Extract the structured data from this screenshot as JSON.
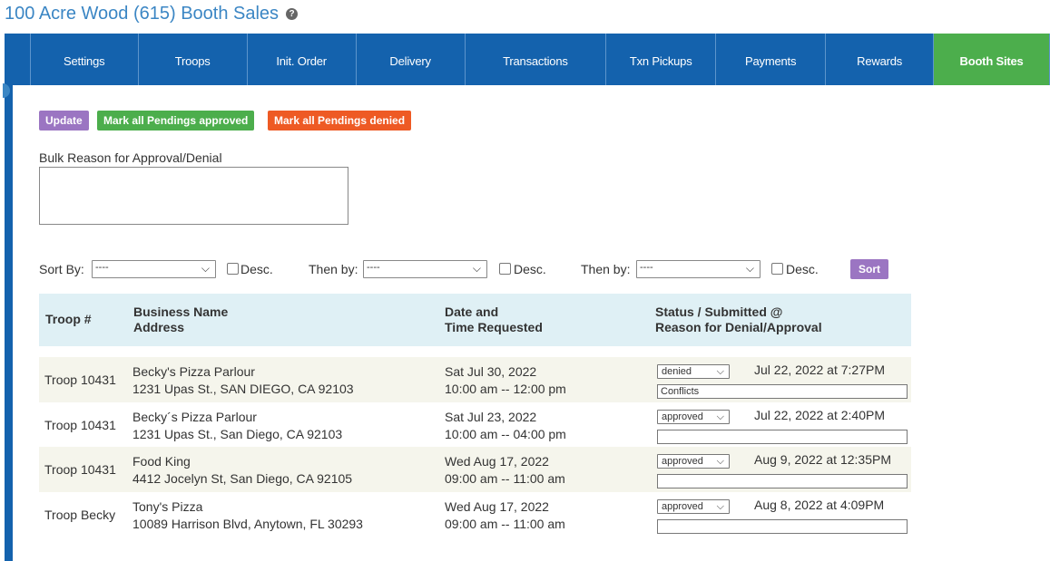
{
  "page_title": "100 Acre Wood (615) Booth Sales",
  "help_icon": "question-circle-icon",
  "nav": {
    "tabs": [
      "Settings",
      "Troops",
      "Init. Order",
      "Delivery",
      "Transactions",
      "Txn Pickups",
      "Payments",
      "Rewards",
      "Booth Sites"
    ],
    "active_tab": "Booth Sites"
  },
  "actions": {
    "update": "Update",
    "approve_all": "Mark all Pendings approved",
    "deny_all": "Mark all Pendings denied"
  },
  "bulk_reason": {
    "label": "Bulk Reason for Approval/Denial",
    "value": ""
  },
  "sort": {
    "sort_by_label": "Sort By:",
    "then_by_label": "Then by:",
    "select_value": "----",
    "desc_label": "Desc.",
    "button": "Sort"
  },
  "table": {
    "headers": {
      "troop": "Troop #",
      "business_1": "Business Name",
      "business_2": "Address",
      "date_1": "Date and",
      "date_2": "Time Requested",
      "status_1": "Status / Submitted @",
      "status_2": "Reason for Denial/Approval"
    },
    "rows": [
      {
        "troop": "Troop 10431",
        "business": "Becky's Pizza Parlour",
        "address": "1231 Upas St., SAN DIEGO, CA 92103",
        "date": "Sat Jul 30, 2022",
        "time": "10:00 am -- 12:00 pm",
        "status": "denied",
        "submitted": "Jul 22, 2022 at 7:27PM",
        "reason": "Conflicts"
      },
      {
        "troop": "Troop 10431",
        "business": "Becky´s Pizza Parlour",
        "address": "1231 Upas St., San Diego, CA 92103",
        "date": "Sat Jul 23, 2022",
        "time": "10:00 am -- 04:00 pm",
        "status": "approved",
        "submitted": "Jul 22, 2022 at 2:40PM",
        "reason": ""
      },
      {
        "troop": "Troop 10431",
        "business": "Food King",
        "address": "4412 Jocelyn St, San Diego, CA 92105",
        "date": "Wed Aug 17, 2022",
        "time": "09:00 am -- 11:00 am",
        "status": "approved",
        "submitted": "Aug 9, 2022 at 12:35PM",
        "reason": ""
      },
      {
        "troop": "Troop Becky",
        "business": "Tony's Pizza",
        "address": "10089 Harrison Blvd, Anytown, FL 30293",
        "date": "Wed Aug 17, 2022",
        "time": "09:00 am -- 11:00 am",
        "status": "approved",
        "submitted": "Aug 8, 2022 at 4:09PM",
        "reason": ""
      }
    ]
  }
}
